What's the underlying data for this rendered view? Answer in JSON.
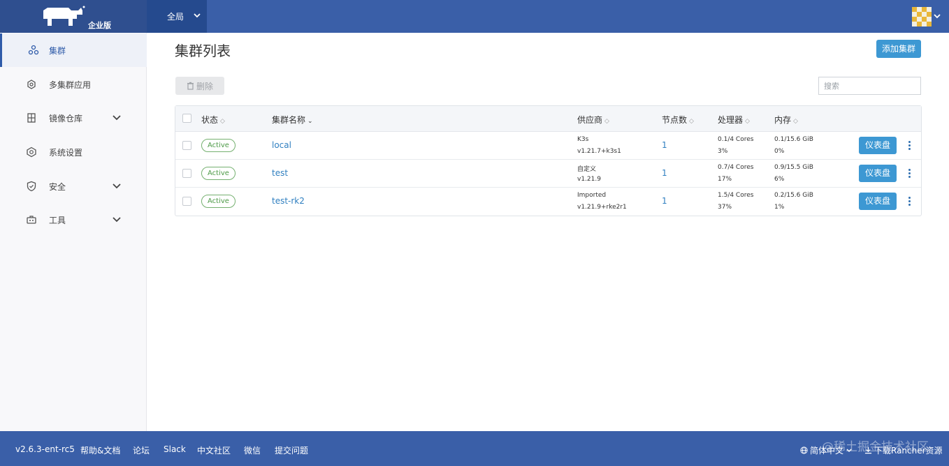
{
  "header": {
    "logo_text": "企业版",
    "scope_label": "全局",
    "colors": {
      "header_bg": "#3a5fa8",
      "logo_bg": "#2f4f8f",
      "scope_bg": "#254a8e"
    }
  },
  "sidebar": {
    "items": [
      {
        "label": "集群",
        "icon": "cluster-icon",
        "active": true,
        "expandable": false
      },
      {
        "label": "多集群应用",
        "icon": "multi-cluster-app-icon",
        "active": false,
        "expandable": false
      },
      {
        "label": "镜像仓库",
        "icon": "registry-icon",
        "active": false,
        "expandable": true
      },
      {
        "label": "系统设置",
        "icon": "settings-icon",
        "active": false,
        "expandable": false
      },
      {
        "label": "安全",
        "icon": "shield-icon",
        "active": false,
        "expandable": true
      },
      {
        "label": "工具",
        "icon": "tools-icon",
        "active": false,
        "expandable": true
      }
    ]
  },
  "main": {
    "title": "集群列表",
    "add_button": "添加集群",
    "delete_button": "删除",
    "search_placeholder": "搜索",
    "accent": "#3d98d3",
    "table": {
      "headers": [
        "状态",
        "集群名称",
        "供应商",
        "节点数",
        "处理器",
        "内存"
      ],
      "rows": [
        {
          "status": "Active",
          "name": "local",
          "provider": "K3s",
          "provider_version": "v1.21.7+k3s1",
          "nodes": "1",
          "cpu": "0.1/4 Cores",
          "cpu_pct": "3%",
          "mem": "0.1/15.6 GiB",
          "mem_pct": "0%",
          "action": "仪表盘"
        },
        {
          "status": "Active",
          "name": "test",
          "provider": "自定义",
          "provider_version": "v1.21.9",
          "nodes": "1",
          "cpu": "0.7/4 Cores",
          "cpu_pct": "17%",
          "mem": "0.9/15.5 GiB",
          "mem_pct": "6%",
          "action": "仪表盘"
        },
        {
          "status": "Active",
          "name": "test-rk2",
          "provider": "Imported",
          "provider_version": "v1.21.9+rke2r1",
          "nodes": "1",
          "cpu": "1.5/4 Cores",
          "cpu_pct": "37%",
          "mem": "0.2/15.6 GiB",
          "mem_pct": "1%",
          "action": "仪表盘"
        }
      ]
    }
  },
  "footer": {
    "version": "v2.6.3-ent-rc5",
    "links": [
      "帮助&文档",
      "论坛",
      "Slack",
      "中文社区",
      "微信",
      "提交问题"
    ],
    "language": "简体中文",
    "download": "下载Rancher资源",
    "watermark": "@稀土掘金技术社区"
  }
}
